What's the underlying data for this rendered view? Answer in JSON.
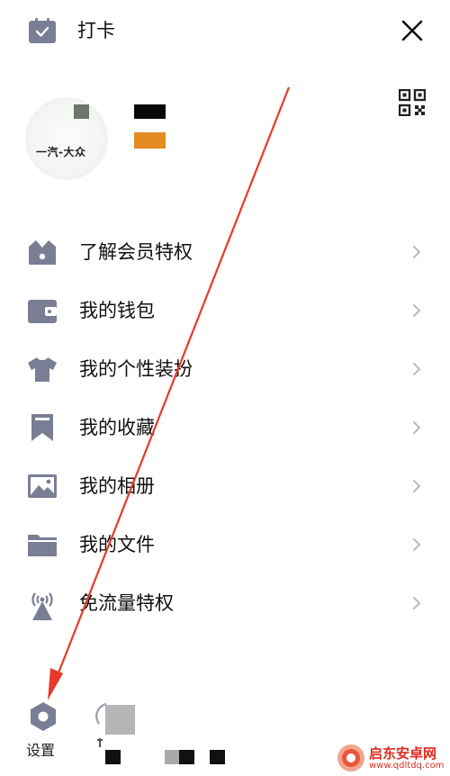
{
  "header": {
    "checkin_label": "打卡",
    "checkin_icon": "calendar-check-icon",
    "close_icon": "close-icon",
    "qr_icon": "qr-code-icon"
  },
  "profile": {
    "avatar_text": "一汽-大众"
  },
  "menu": {
    "items": [
      {
        "label": "了解会员特权",
        "icon": "crown-icon"
      },
      {
        "label": "我的钱包",
        "icon": "wallet-icon"
      },
      {
        "label": "我的个性装扮",
        "icon": "tshirt-icon"
      },
      {
        "label": "我的收藏",
        "icon": "bookmark-icon"
      },
      {
        "label": "我的相册",
        "icon": "photo-album-icon"
      },
      {
        "label": "我的文件",
        "icon": "folder-icon"
      },
      {
        "label": "免流量特权",
        "icon": "signal-tower-icon"
      }
    ]
  },
  "footer": {
    "settings_label": "设置",
    "settings_icon": "gear-icon"
  },
  "watermark": {
    "title": "启东安卓网",
    "url": "www.qdltdq.com"
  },
  "colors": {
    "icon_gray": "#7a7e94",
    "annotation_red": "#e8392b",
    "accent_orange": "#e48b22"
  }
}
